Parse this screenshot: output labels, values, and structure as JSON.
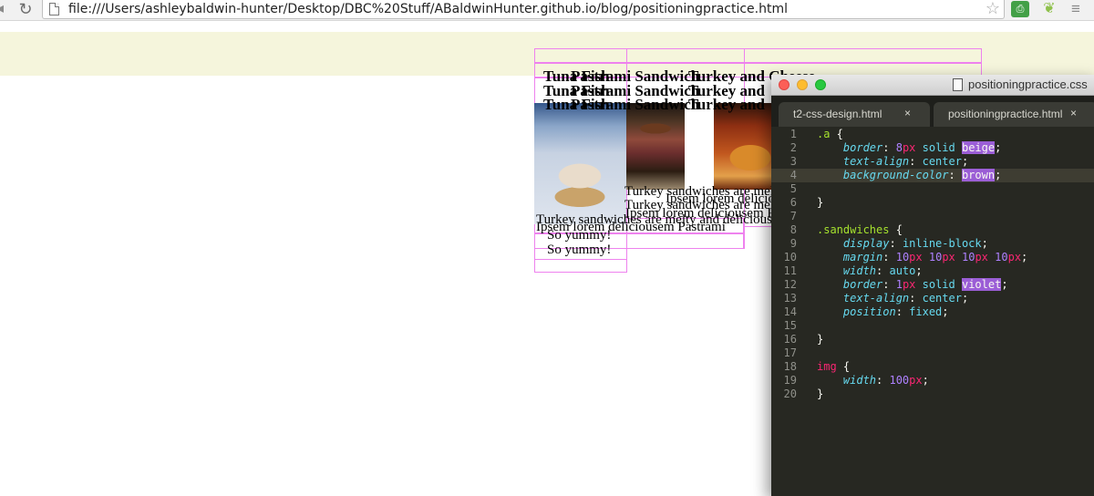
{
  "browser": {
    "url": "file:///Users/ashleybaldwin-hunter/Desktop/DBC%20Stuff/ABaldwinHunter.github.io/blog/positioningpractice.html",
    "icons": [
      "back-arrow",
      "reload-icon",
      "page-icon",
      "star-icon",
      "printer-extension-icon",
      "leaf-extension-icon",
      "menu-icon"
    ]
  },
  "page": {
    "band_color": "#f5f5dc",
    "guide_color": "#ee82ee",
    "titles": {
      "t1": "Tuna Fish",
      "t2": "Pastrami Sandwich",
      "t3": "Turkey and Cheese",
      "t4": "Tuna Fish",
      "t5": "Pastrami Sandwich",
      "t6": "Turkey and",
      "t7": "Tuna Fish",
      "t8": "Pastrami Sandwich",
      "t9": "Turkey and"
    },
    "text": {
      "m1": "Turkey sandwiches are melty and delicious",
      "m2": "Turkey sandwiches are melty and delicious",
      "m3": "Turkey sandwiches are melty and delicious",
      "p1": "Ipsem lorem deliciousem Pastrami",
      "p2": "Ipsem lorem deliciousem Pastrami",
      "p3": "Ipsem lorem deliciousem Pastrami",
      "y1": "So yummy!",
      "y2": "So yummy!"
    }
  },
  "editor": {
    "window_title": "positioningpractice.css",
    "tabs": [
      {
        "label": "t2-css-design.html",
        "close": "×"
      },
      {
        "label": "positioningpractice.html",
        "close": "×"
      }
    ],
    "line_numbers": [
      "1",
      "2",
      "3",
      "4",
      "5",
      "6",
      "7",
      "8",
      "9",
      "10",
      "11",
      "12",
      "13",
      "14",
      "15",
      "16",
      "17",
      "18",
      "19",
      "20"
    ],
    "lines": [
      {
        "sel": ".a",
        "punc": " {"
      },
      {
        "prop": "border",
        "sep": ": ",
        "num": "8",
        "unit": "px",
        "val": " solid ",
        "color": "beige",
        "end": ";"
      },
      {
        "prop": "text-align",
        "sep": ": ",
        "val": "center",
        "end": ";"
      },
      {
        "prop": "background-color",
        "sep": ": ",
        "color": "brown",
        "end": ";"
      },
      {},
      {
        "punc": "}"
      },
      {},
      {
        "sel": ".sandwiches",
        "punc": " {"
      },
      {
        "prop": "display",
        "sep": ": ",
        "val": "inline-block",
        "end": ";"
      },
      {
        "prop": "margin",
        "sep": ": ",
        "n1": "10",
        "u1": "px",
        "n2": "10",
        "u2": "px",
        "n3": "10",
        "u3": "px",
        "n4": "10",
        "u4": "px",
        "end": ";"
      },
      {
        "prop": "width",
        "sep": ": ",
        "val": "auto",
        "end": ";"
      },
      {
        "prop": "border",
        "sep": ": ",
        "num": "1",
        "unit": "px",
        "val": " solid ",
        "color": "violet",
        "end": ";"
      },
      {
        "prop": "text-align",
        "sep": ": ",
        "val": "center",
        "end": ";"
      },
      {
        "prop": "position",
        "sep": ": ",
        "val": "fixed",
        "end": ";"
      },
      {},
      {
        "punc": "}"
      },
      {},
      {
        "tag": "img",
        "punc": " {"
      },
      {
        "prop": "width",
        "sep": ": ",
        "num": "100",
        "unit": "px",
        "end": ";"
      },
      {
        "punc": "}"
      }
    ]
  }
}
